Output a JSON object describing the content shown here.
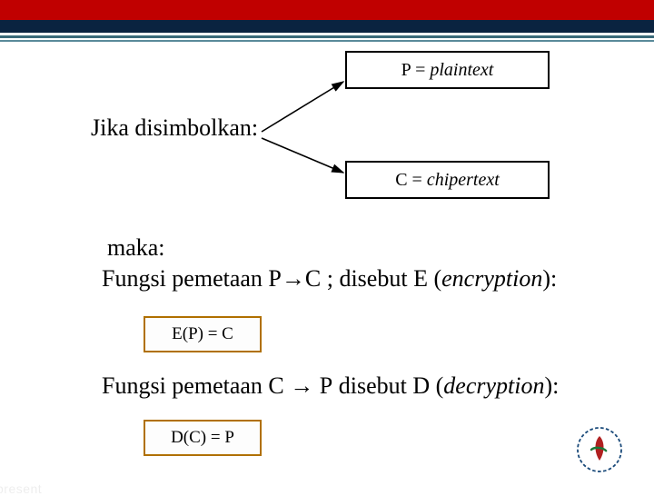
{
  "boxP": {
    "sym": "P",
    "eq": " = ",
    "word": "plaintext"
  },
  "boxC": {
    "sym": "C",
    "eq": " = ",
    "word": "chipertext"
  },
  "labels": {
    "jika": "Jika disimbolkan:",
    "maka": "maka:"
  },
  "enc": {
    "prefix": "Fungsi pemetaan ",
    "p": "P",
    "arrow": "→",
    "c": "C",
    "mid": "  ; disebut ",
    "e": "E",
    "paren_open": " (",
    "word": "encryption",
    "paren_close": "):"
  },
  "dec": {
    "prefix": "Fungsi pemetaan ",
    "c": "C",
    "arrow": " → ",
    "p": "P",
    "mid": " disebut ",
    "d": "D",
    "paren_open": " (",
    "word": "decryption",
    "paren_close": "):"
  },
  "boxE": "E(P) = C",
  "boxD": "D(C) = P"
}
